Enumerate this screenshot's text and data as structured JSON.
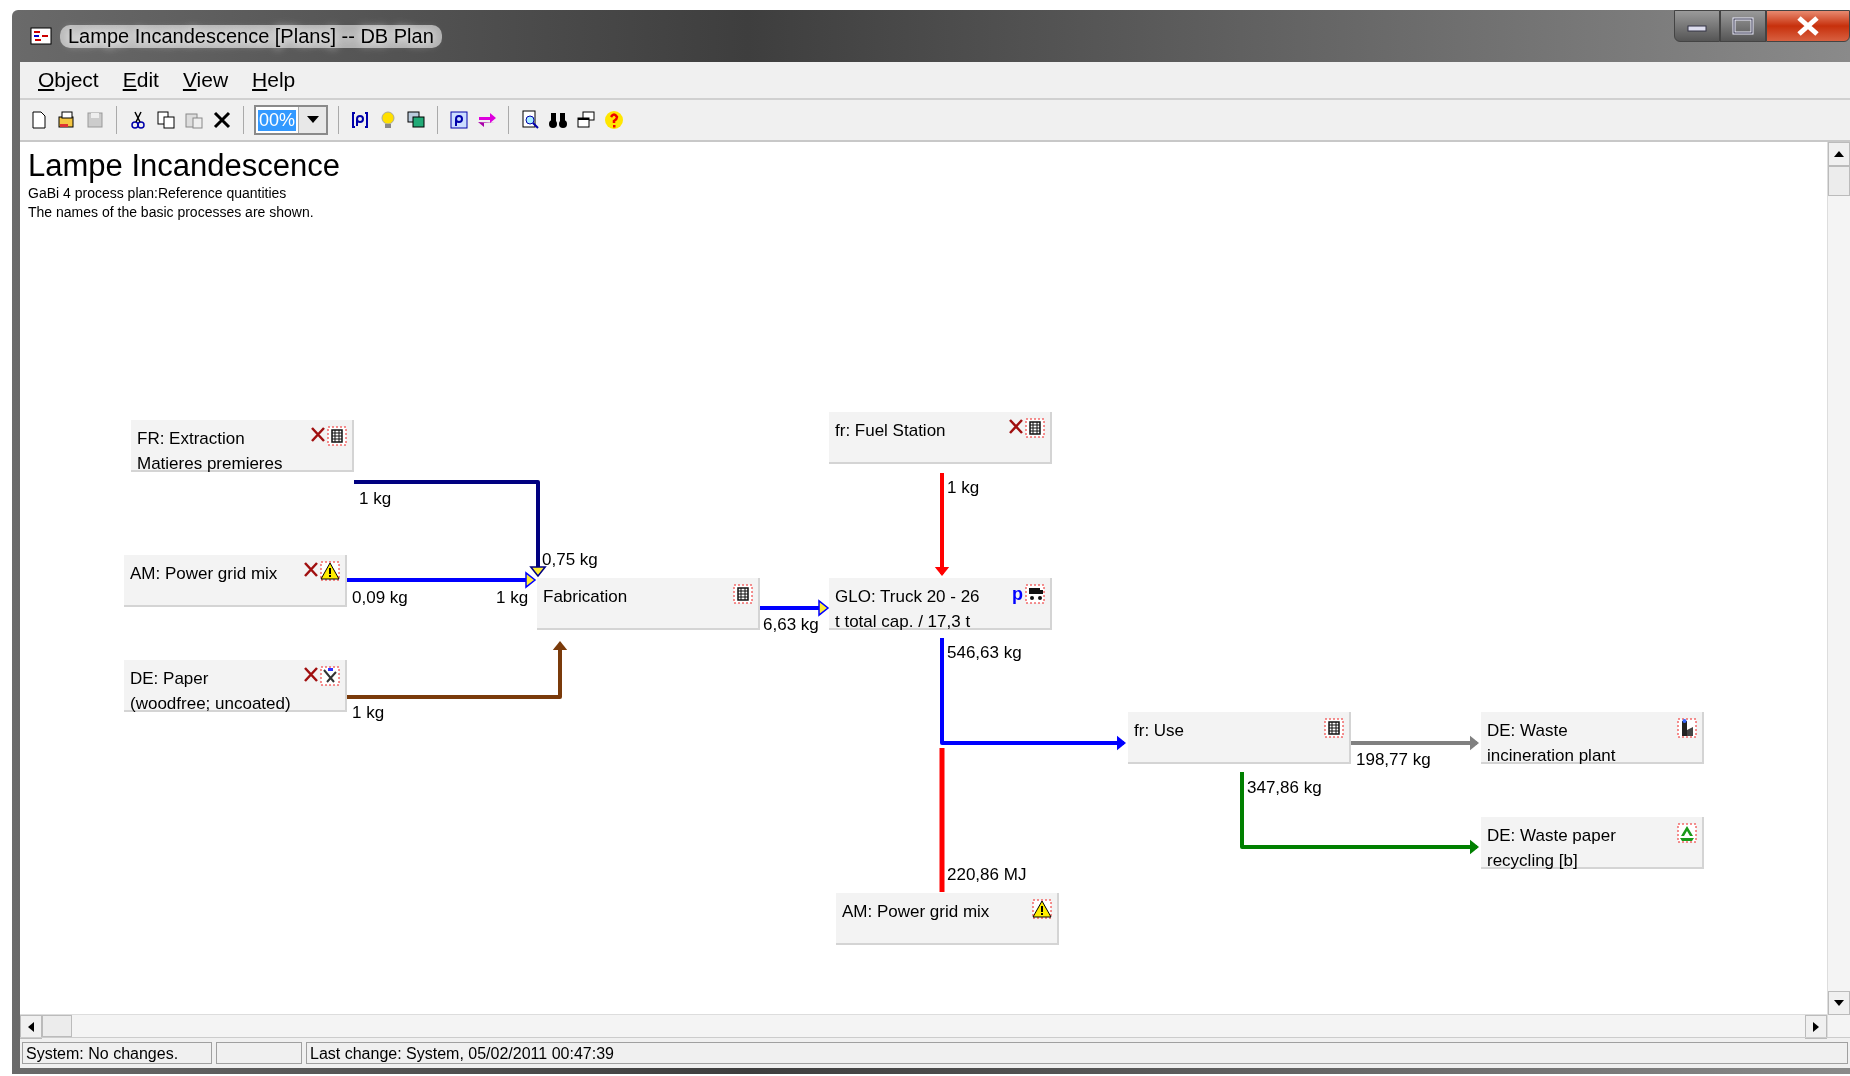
{
  "window": {
    "title": "Lampe Incandescence [Plans] -- DB Plan"
  },
  "menu": [
    {
      "label": "Object"
    },
    {
      "label": "Edit"
    },
    {
      "label": "View"
    },
    {
      "label": "Help"
    }
  ],
  "toolbar": {
    "zoom_value": "00%"
  },
  "plan": {
    "title": "Lampe Incandescence",
    "subtitle": "GaBi 4 process plan:Reference quantities",
    "note": "The names of the basic processes are shown."
  },
  "nodes": [
    {
      "lines": [
        "FR: Extraction",
        "Matieres premieres"
      ],
      "flagged": true
    },
    {
      "lines": [
        "AM: Power grid mix"
      ],
      "flagged": true
    },
    {
      "lines": [
        "DE: Paper",
        "(woodfree; uncoated)"
      ],
      "flagged": true
    },
    {
      "lines": [
        "Fabrication"
      ],
      "flagged": false
    },
    {
      "lines": [
        "fr: Fuel Station"
      ],
      "flagged": true
    },
    {
      "lines": [
        "GLO: Truck 20 - 26",
        "t total cap. / 17,3 t"
      ],
      "flagged": false,
      "badge": "p"
    },
    {
      "lines": [
        "AM: Power grid mix"
      ],
      "flagged": false
    },
    {
      "lines": [
        "fr: Use"
      ],
      "flagged": false
    },
    {
      "lines": [
        "DE: Waste",
        "incineration plant"
      ],
      "flagged": false
    },
    {
      "lines": [
        "DE: Waste paper",
        "recycling [b]"
      ],
      "flagged": false
    }
  ],
  "flows": [
    {
      "color": "#000080",
      "amounts": [
        "1 kg",
        "0,75 kg"
      ]
    },
    {
      "color": "#0000ff",
      "amounts": [
        "0,09 kg",
        "1 kg"
      ]
    },
    {
      "color": "#7a3a0a",
      "amounts": [
        "1 kg"
      ]
    },
    {
      "color": "#0000ff",
      "amounts": [
        "6,63 kg"
      ]
    },
    {
      "color": "#ff0000",
      "amounts": [
        "1 kg"
      ]
    },
    {
      "color": "#0000ff",
      "amounts": [
        "546,63 kg"
      ]
    },
    {
      "color": "#ff0000",
      "amounts": [
        "220,86 MJ"
      ]
    },
    {
      "color": "#808080",
      "amounts": [
        "198,77 kg"
      ]
    },
    {
      "color": "#008000",
      "amounts": [
        "347,86 kg"
      ]
    }
  ],
  "status_bar": {
    "state": "System: No changes.",
    "last_change": "Last change: System, 05/02/2011 00:47:39"
  }
}
